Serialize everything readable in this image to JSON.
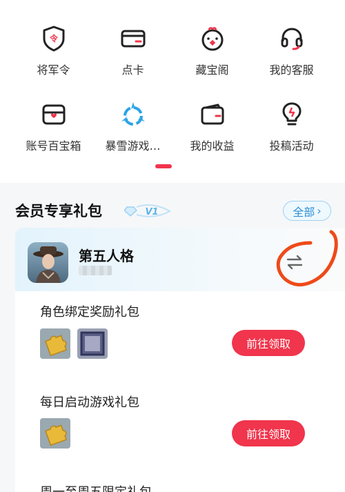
{
  "shortcuts": [
    {
      "label": "将军令",
      "icon": "shield-badge-icon"
    },
    {
      "label": "点卡",
      "icon": "card-icon"
    },
    {
      "label": "藏宝阁",
      "icon": "treasure-pavilion-icon"
    },
    {
      "label": "我的客服",
      "icon": "headset-icon"
    },
    {
      "label": "账号百宝箱",
      "icon": "toolbox-icon"
    },
    {
      "label": "暴雪游戏…",
      "icon": "blizzard-icon"
    },
    {
      "label": "我的收益",
      "icon": "wallet-icon"
    },
    {
      "label": "投稿活动",
      "icon": "lightbulb-icon"
    }
  ],
  "members": {
    "title": "会员专享礼包",
    "badge": "V1",
    "all_label": "全部",
    "all_chevron": "›"
  },
  "game": {
    "name": "第五人格"
  },
  "gifts": [
    {
      "title": "角色绑定奖励礼包",
      "button": "前往领取",
      "items": [
        "puzzle-item",
        "frame-item"
      ]
    },
    {
      "title": "每日启动游戏礼包",
      "button": "前往领取",
      "items": [
        "puzzle-item"
      ]
    },
    {
      "title": "周一至周五限定礼包"
    }
  ],
  "colors": {
    "accent": "#f0354c",
    "link": "#2e8fd6",
    "annotation": "#ee4a1a"
  }
}
